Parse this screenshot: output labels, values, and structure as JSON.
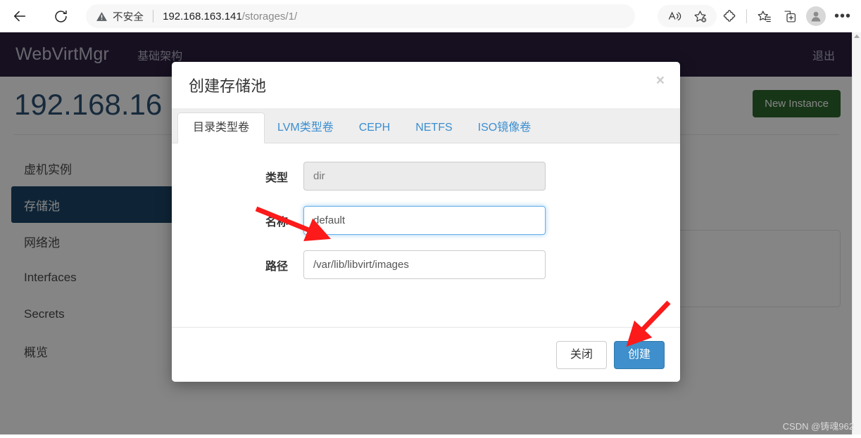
{
  "browser": {
    "back_label": "back-arrow",
    "reload_label": "reload",
    "security_text": "不安全",
    "url_host": "192.168.163.141",
    "url_path": "/storages/1/",
    "icons": [
      "read-aloud-icon",
      "add-favorite-icon",
      "extensions-icon",
      "collections-icon",
      "split-screen-icon",
      "profile-avatar",
      "settings-more-icon"
    ],
    "more_label": "•••"
  },
  "navbar": {
    "brand": "WebVirtMgr",
    "link": "基础架构",
    "logout": "退出",
    "bg_color": "#2b2040"
  },
  "page": {
    "title": "192.168.16",
    "new_instance_label": "New Instance",
    "new_instance_color": "#2c662d"
  },
  "sidebar": {
    "items": [
      {
        "label": "虚机实例",
        "active": false
      },
      {
        "label": "存储池",
        "active": true
      },
      {
        "label": "网络池",
        "active": false
      },
      {
        "label": "Interfaces",
        "active": false
      },
      {
        "label": "Secrets",
        "active": false
      },
      {
        "label": "概览",
        "active": false
      }
    ],
    "active_color": "#1b4669"
  },
  "modal": {
    "title": "创建存储池",
    "close_label": "×",
    "tabs": [
      {
        "label": "目录类型卷",
        "active": true
      },
      {
        "label": "LVM类型卷",
        "active": false
      },
      {
        "label": "CEPH",
        "active": false
      },
      {
        "label": "NETFS",
        "active": false
      },
      {
        "label": "ISO镜像卷",
        "active": false
      }
    ],
    "fields": [
      {
        "label": "类型",
        "value": "dir",
        "state": "disabled"
      },
      {
        "label": "名称",
        "value": "default",
        "state": "focused"
      },
      {
        "label": "路径",
        "value": "/var/lib/libvirt/images",
        "state": "normal"
      }
    ],
    "close_button": "关闭",
    "create_button": "创建",
    "primary_color": "#3e8fcb"
  },
  "annotation": {
    "arrow_color": "#fc1a1a",
    "arrow_1_target": "名称-input",
    "arrow_2_target": "创建-button"
  },
  "watermark": "CSDN @铸魂962"
}
